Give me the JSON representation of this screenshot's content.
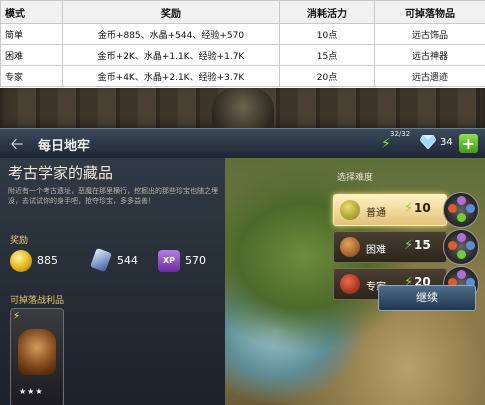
{
  "table": {
    "headers": [
      "模式",
      "奖励",
      "消耗活力",
      "可掉落物品"
    ],
    "rows": [
      {
        "mode": "简单",
        "reward": "金币+885、水晶+544、经验+570",
        "cost": "10点",
        "drop": "远古饰品"
      },
      {
        "mode": "困难",
        "reward": "金币+2K、水晶+1.1K、经验+1.7K",
        "cost": "15点",
        "drop": "远古神器"
      },
      {
        "mode": "专家",
        "reward": "金币+4K、水晶+2.1K、经验+3.7K",
        "cost": "20点",
        "drop": "远古遗迹"
      }
    ]
  },
  "game": {
    "title": "每日地牢",
    "energy": "32/32",
    "gems": "34",
    "panel_title": "考古学家的藏品",
    "description": "附近有一个考古遗址，恶魔在那里横行，挖掘出的那些珍宝也随之埋没，去试试你的身手吧，抢夺珍宝，多多益善！",
    "reward_label": "奖励",
    "rewards": {
      "gold": "885",
      "crystal": "544",
      "xp_badge": "XP",
      "xp": "570"
    },
    "loot_label": "可掉落战利品",
    "loot_stars": "★★★",
    "difficulty_label": "选择难度",
    "difficulties": [
      {
        "name": "普通",
        "cost": "10"
      },
      {
        "name": "困难",
        "cost": "15"
      },
      {
        "name": "专家",
        "cost": "20"
      }
    ],
    "continue": "继续"
  },
  "colors": {
    "energy_green": "#7fdb3f",
    "gold_text": "#e6c86a",
    "selected": "#fff2c4"
  }
}
